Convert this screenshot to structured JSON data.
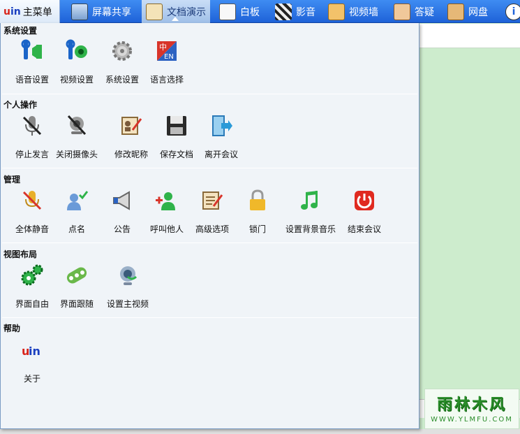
{
  "toolbar": {
    "main_menu": "主菜单",
    "logo_text": "uin",
    "items": [
      "屏幕共享",
      "文档演示",
      "白板",
      "影音",
      "视频墙",
      "答疑",
      "网盘"
    ]
  },
  "menu": {
    "sections": [
      {
        "title": "系统设置",
        "items": [
          "语音设置",
          "视频设置",
          "系统设置",
          "语言选择"
        ]
      },
      {
        "title": "个人操作",
        "items": [
          "停止发言",
          "关闭摄像头",
          "修改昵称",
          "保存文档",
          "离开会议"
        ]
      },
      {
        "title": "管理",
        "items": [
          "全体静音",
          "点名",
          "公告",
          "呼叫他人",
          "高级选项",
          "锁门",
          "设置背景音乐",
          "结束会议"
        ]
      },
      {
        "title": "视图布局",
        "items": [
          "界面自由",
          "界面跟随",
          "设置主视频"
        ]
      },
      {
        "title": "帮助",
        "items": [
          "关于"
        ]
      }
    ]
  },
  "lang_icon": {
    "top": "中",
    "bottom": "EN"
  },
  "watermark": {
    "title": "雨林木风",
    "url": "WWW.YLMFU.COM"
  },
  "colors": {
    "toolbar": "#1e62d8",
    "background": "#cdeccd",
    "menu": "#f0f4f8"
  }
}
